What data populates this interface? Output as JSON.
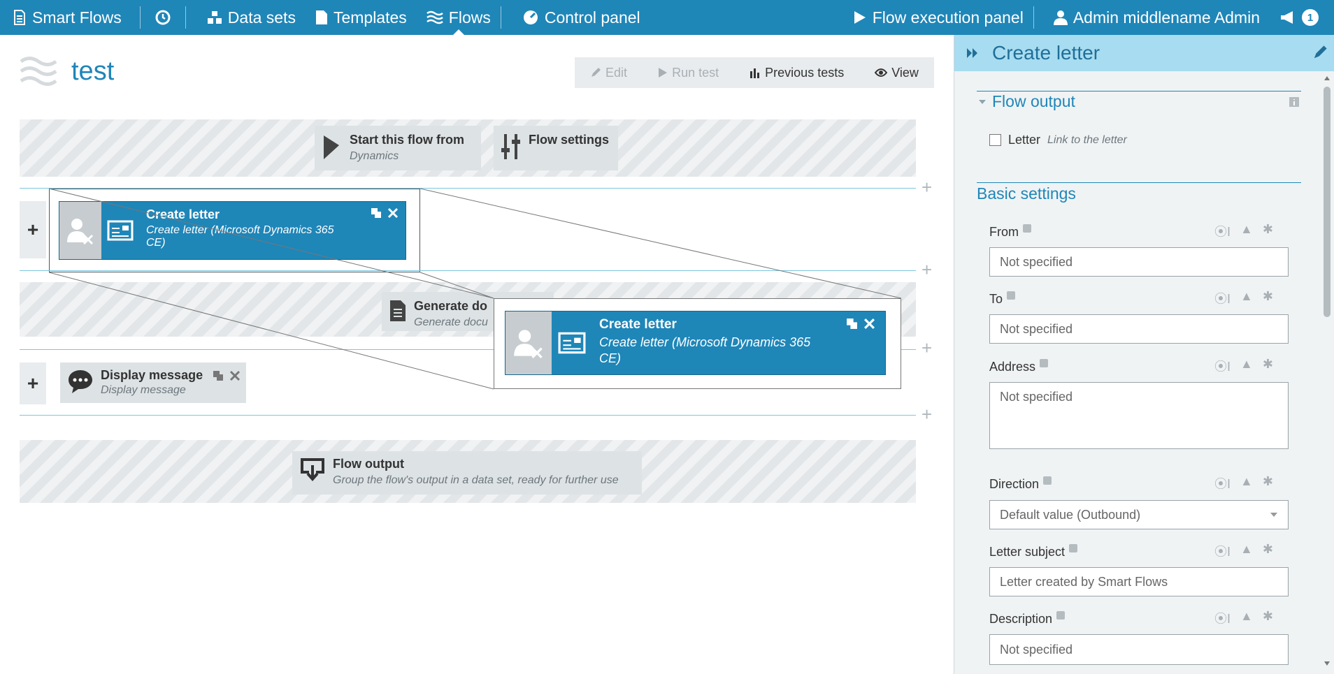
{
  "topbar": {
    "brand": "Smart Flows",
    "nav": [
      "Data sets",
      "Templates",
      "Flows",
      "Control panel"
    ],
    "execution_panel": "Flow execution panel",
    "user": "Admin middlename Admin",
    "notifications": "1"
  },
  "main": {
    "title": "test",
    "toolbar": {
      "edit": "Edit",
      "run_test": "Run test",
      "previous_tests": "Previous tests",
      "view": "View"
    },
    "start_block": {
      "title": "Start this flow from",
      "subtitle": "Dynamics"
    },
    "settings_block": {
      "title": "Flow settings"
    },
    "create_letter": {
      "title": "Create letter",
      "subtitle_1": "Create letter (Microsoft Dynamics 365",
      "subtitle_2": "CE)"
    },
    "generate_doc": {
      "title": "Generate do",
      "subtitle": "Generate docu"
    },
    "display_message": {
      "title": "Display message",
      "subtitle": "Display message"
    },
    "flow_output": {
      "title": "Flow output",
      "subtitle": "Group the flow's output in a data set, ready for further use"
    },
    "plus": "+"
  },
  "panel": {
    "title": "Create letter",
    "flow_output_section": "Flow output",
    "letter_label": "Letter",
    "letter_hint": "Link to the letter",
    "basic_settings": "Basic settings",
    "fields": {
      "from": {
        "label": "From",
        "value": "Not specified"
      },
      "to": {
        "label": "To",
        "value": "Not specified"
      },
      "address": {
        "label": "Address",
        "value": "Not specified"
      },
      "direction": {
        "label": "Direction",
        "value": "Default value (Outbound)"
      },
      "letter_subject": {
        "label": "Letter subject",
        "value": "Letter created by Smart Flows"
      },
      "description": {
        "label": "Description",
        "value": "Not specified"
      }
    }
  },
  "colors": {
    "primary": "#1f86b8",
    "panel_header": "#a8dcf0",
    "muted": "#a9b0b5"
  },
  "icons": [
    "flows-logo-icon",
    "history-icon",
    "datasets-icon",
    "templates-icon",
    "flows-icon",
    "gauge-icon",
    "play-icon",
    "user-icon",
    "megaphone-icon",
    "pencil-icon",
    "chart-icon",
    "eye-icon",
    "dynamics-icon",
    "sliders-icon",
    "document-icon",
    "chat-icon",
    "output-icon",
    "copy-icon",
    "close-icon",
    "collapse-icon",
    "info-icon",
    "expression-icon",
    "person-icon",
    "asterisk-icon",
    "caret-down-icon"
  ]
}
